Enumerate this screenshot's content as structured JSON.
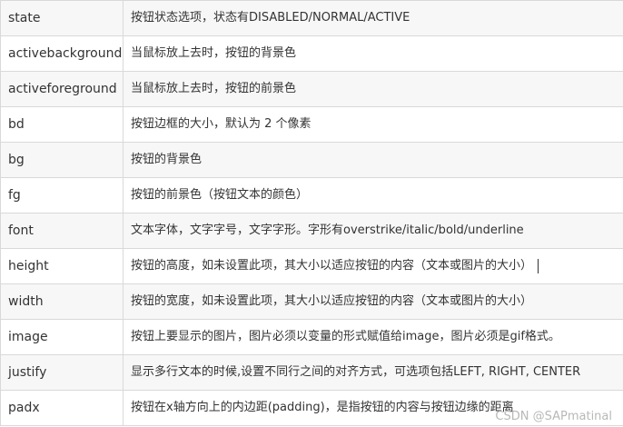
{
  "rows": [
    {
      "key": "state",
      "desc": "按钮状态选项，状态有DISABLED/NORMAL/ACTIVE"
    },
    {
      "key": "activebackground",
      "desc": "当鼠标放上去时，按钮的背景色"
    },
    {
      "key": "activeforeground",
      "desc": "当鼠标放上去时，按钮的前景色"
    },
    {
      "key": "bd",
      "desc": "按钮边框的大小，默认为 2 个像素"
    },
    {
      "key": "bg",
      "desc": "按钮的背景色"
    },
    {
      "key": "fg",
      "desc": "按钮的前景色（按钮文本的颜色）"
    },
    {
      "key": "font",
      "desc": "文本字体，文字字号，文字字形。字形有overstrike/italic/bold/underline"
    },
    {
      "key": "height",
      "desc": "按钮的高度，如未设置此项，其大小以适应按钮的内容（文本或图片的大小）"
    },
    {
      "key": "width",
      "desc": "按钮的宽度，如未设置此项，其大小以适应按钮的内容（文本或图片的大小）"
    },
    {
      "key": "image",
      "desc": "按钮上要显示的图片，图片必须以变量的形式赋值给image，图片必须是gif格式。"
    },
    {
      "key": "justify",
      "desc": "显示多行文本的时候,设置不同行之间的对齐方式，可选项包括LEFT, RIGHT, CENTER"
    },
    {
      "key": "padx",
      "desc": "按钮在x轴方向上的内边距(padding)，是指按钮的内容与按钮边缘的距离"
    }
  ],
  "watermark": "CSDN @SAPmatinal"
}
